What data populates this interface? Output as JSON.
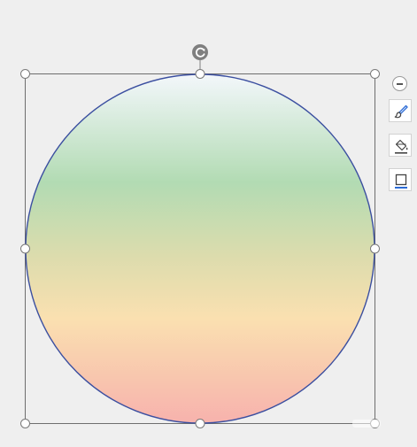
{
  "canvas": {
    "background": "#efefef"
  },
  "shape": {
    "type": "circle",
    "outline_color": "#3b4fa0",
    "fill_gradient": [
      "#f3f7fb",
      "#b2dbb3",
      "#dcdcad",
      "#fae0b0",
      "#f7b2ad"
    ],
    "selected": true
  },
  "selection": {
    "frame_color": "#6e6e6e",
    "handle_fill": "#ffffff",
    "handle_stroke": "#7a7a7a",
    "rotate_handle_color": "#7f7f7f"
  },
  "side_toolbar": {
    "collapse_icon": "minus-circle-icon",
    "buttons": [
      {
        "name": "style-button",
        "icon": "brush-icon"
      },
      {
        "name": "fill-button",
        "icon": "paint-bucket-icon"
      },
      {
        "name": "outline-button",
        "icon": "shape-outline-icon"
      }
    ],
    "accent": "#2b6bd6"
  }
}
